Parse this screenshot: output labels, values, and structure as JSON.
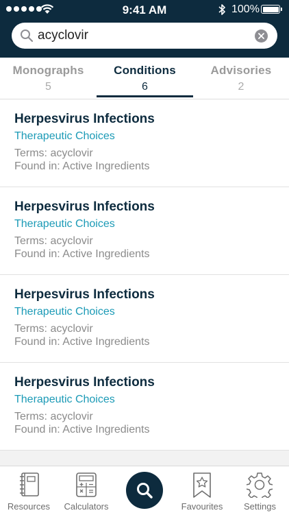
{
  "status_bar": {
    "time": "9:41 AM",
    "battery": "100%"
  },
  "search": {
    "value": "acyclovir",
    "placeholder": ""
  },
  "tabs": [
    {
      "label": "Monographs",
      "count": "5",
      "active": false
    },
    {
      "label": "Conditions",
      "count": "6",
      "active": true
    },
    {
      "label": "Advisories",
      "count": "2",
      "active": false
    }
  ],
  "results": [
    {
      "title": "Herpesvirus Infections",
      "subtitle": "Therapeutic Choices",
      "terms": "Terms: acyclovir",
      "found_in": "Found in: Active Ingredients"
    },
    {
      "title": "Herpesvirus Infections",
      "subtitle": "Therapeutic Choices",
      "terms": "Terms: acyclovir",
      "found_in": "Found in: Active Ingredients"
    },
    {
      "title": "Herpesvirus Infections",
      "subtitle": "Therapeutic Choices",
      "terms": "Terms: acyclovir",
      "found_in": "Found in: Active Ingredients"
    },
    {
      "title": "Herpesvirus Infections",
      "subtitle": "Therapeutic Choices",
      "terms": "Terms: acyclovir",
      "found_in": "Found in: Active Ingredients"
    }
  ],
  "tab_bar": {
    "resources": "Resources",
    "calculators": "Calculators",
    "favourites": "Favourites",
    "settings": "Settings"
  },
  "colors": {
    "header": "#0d2b3e",
    "accent": "#1b9ab6",
    "muted": "#8b8b8b"
  }
}
